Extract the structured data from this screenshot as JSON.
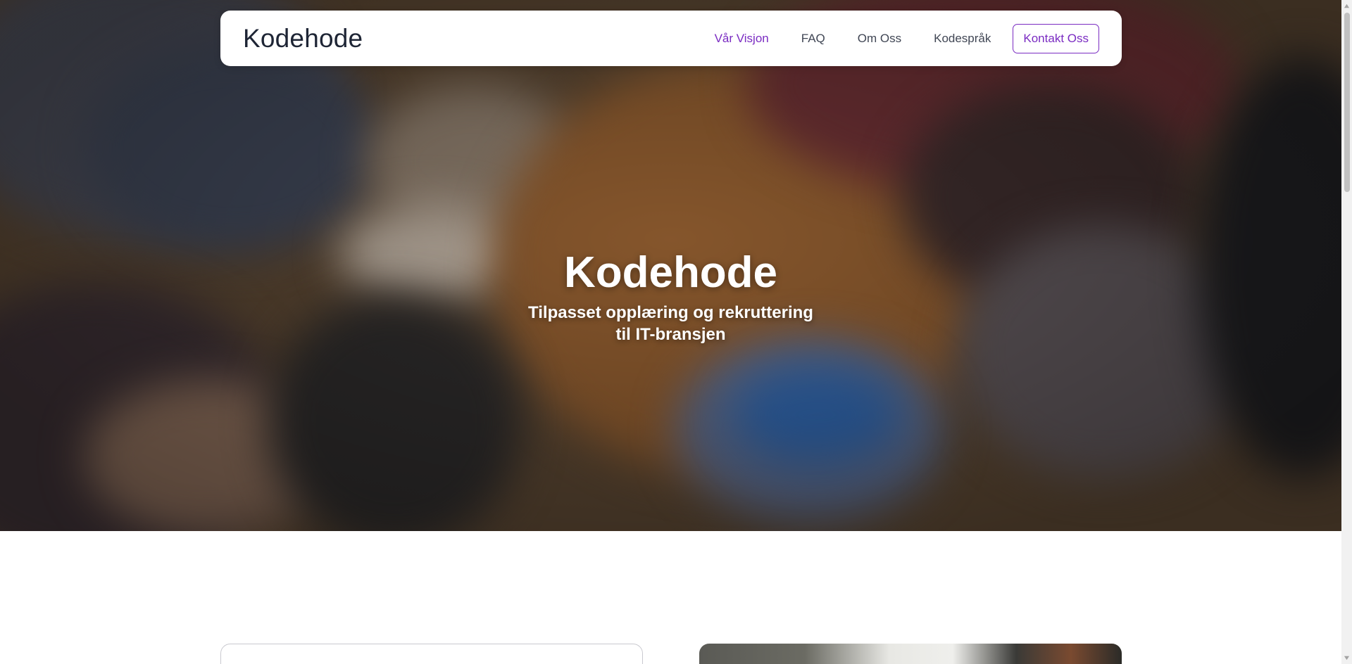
{
  "brand": "Kodehode",
  "nav": {
    "items": [
      {
        "label": "Vår Visjon",
        "active": true
      },
      {
        "label": "FAQ",
        "active": false
      },
      {
        "label": "Om Oss",
        "active": false
      },
      {
        "label": "Kodespråk",
        "active": false
      }
    ],
    "cta": "Kontakt Oss"
  },
  "hero": {
    "title": "Kodehode",
    "subtitle": "Tilpasset opplæring og rekruttering til IT-bransjen"
  },
  "colors": {
    "accent": "#7a2bc2",
    "text_dark": "#1e2535",
    "nav_text": "#404654"
  },
  "icons": {
    "scroll_up": "triangle-up",
    "scroll_down": "triangle-down"
  }
}
